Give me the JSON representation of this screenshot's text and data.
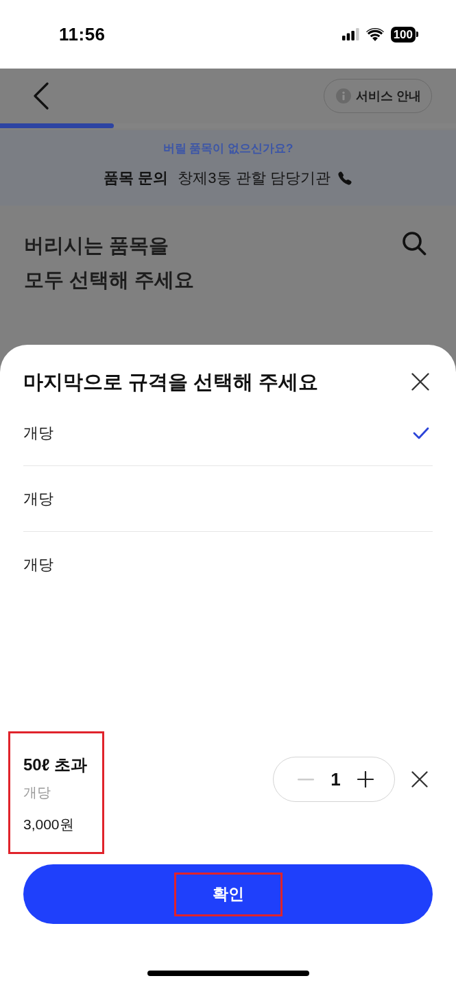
{
  "status_bar": {
    "time": "11:56",
    "battery": "100"
  },
  "header": {
    "service_guide": "서비스 안내",
    "progress": {
      "level": 0.25
    }
  },
  "banner": {
    "question": "버릴 품목이 없으신가요?",
    "inquiry_label": "품목 문의",
    "inquiry_text": "창제3동 관할 담당기관"
  },
  "page_title": "버리시는 품목을\n모두 선택해 주세요",
  "sheet": {
    "title": "마지막으로 규격을 선택해 주세요",
    "options": [
      {
        "label": "개당",
        "selected": true
      },
      {
        "label": "개당",
        "selected": false
      },
      {
        "label": "개당",
        "selected": false
      }
    ],
    "selection": {
      "name": "50ℓ 초과",
      "unit": "개당",
      "price": "3,000원",
      "quantity": "1",
      "decrease_disabled": true,
      "highlighted": true
    },
    "confirm": {
      "label": "확인",
      "highlighted": true
    }
  }
}
